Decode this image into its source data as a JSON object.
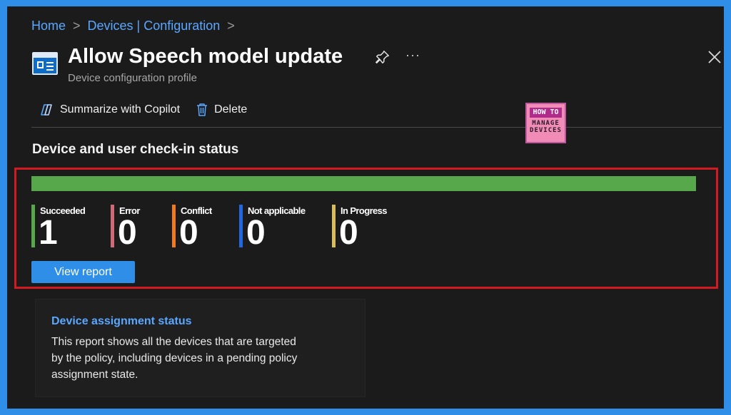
{
  "breadcrumb": {
    "home": "Home",
    "devices": "Devices | Configuration",
    "sep1": ">",
    "sep2": ">"
  },
  "header": {
    "title": "Allow Speech model update",
    "subtitle": "Device configuration profile",
    "more": "···"
  },
  "toolbar": {
    "copilot_label": "Summarize with Copilot",
    "delete_label": "Delete"
  },
  "logo": {
    "line1": "HOW TO",
    "line2": "MANAGE",
    "line3": "DEVICES"
  },
  "checkin": {
    "title": "Device and user check-in status",
    "progress_fraction": 1.0,
    "progress_color": "#57a84a",
    "stats": [
      {
        "label": "Succeeded",
        "value": "1",
        "color": "#57a84a"
      },
      {
        "label": "Error",
        "value": "0",
        "color": "#d06a78"
      },
      {
        "label": "Conflict",
        "value": "0",
        "color": "#f07a22"
      },
      {
        "label": "Not applicable",
        "value": "0",
        "color": "#2266e0"
      },
      {
        "label": "In Progress",
        "value": "0",
        "color": "#d9bd5a"
      }
    ],
    "view_report_label": "View report"
  },
  "assignment_card": {
    "title": "Device assignment status",
    "description": "This report shows all the devices that are targeted by the policy, including devices in a pending policy assignment state."
  },
  "colors": {
    "accent": "#2f8fe8",
    "link": "#5aa7ff",
    "highlight": "#d21a22",
    "background": "#1b1b1b"
  }
}
